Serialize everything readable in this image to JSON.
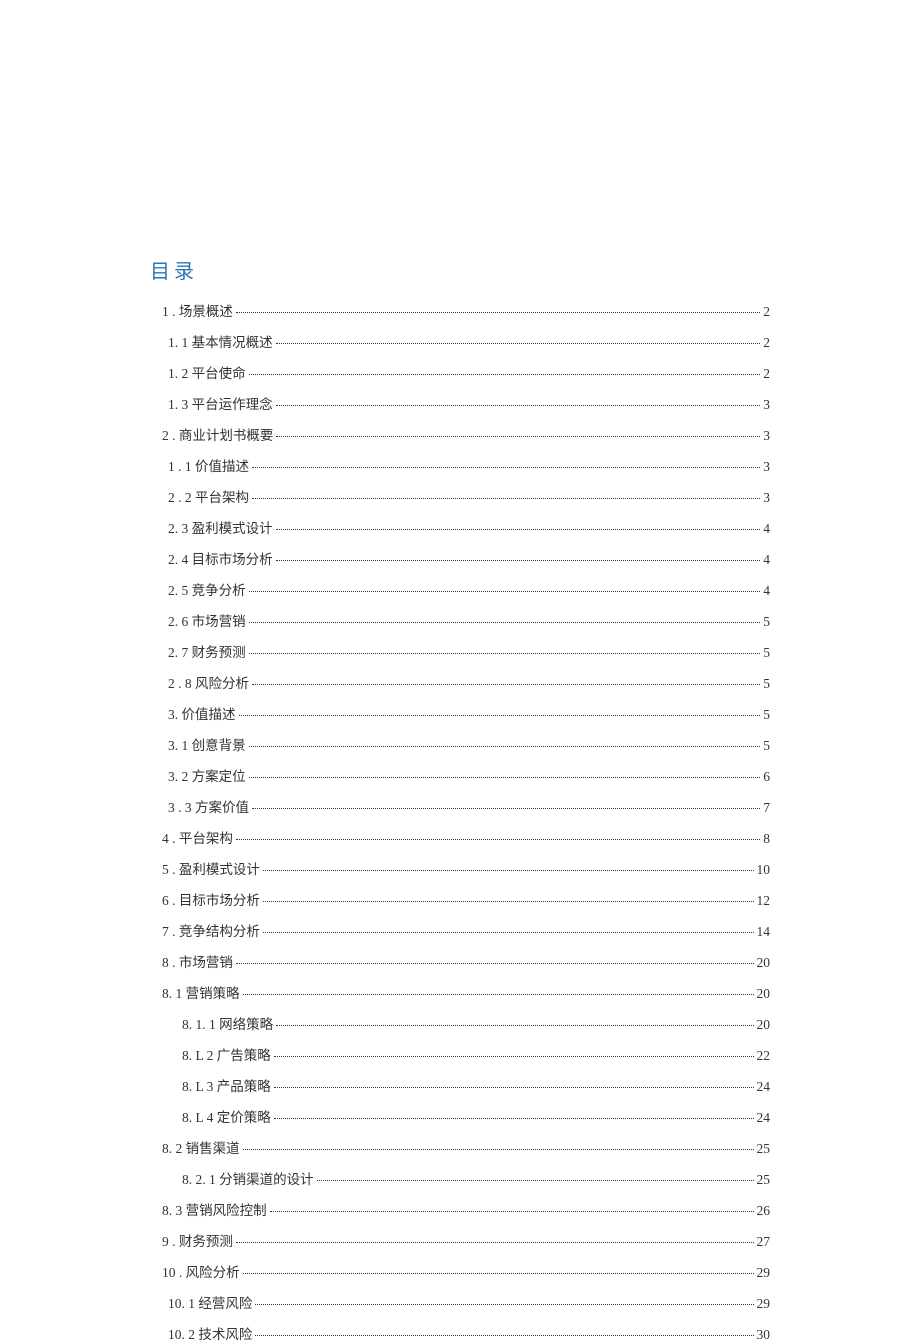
{
  "heading": "目录",
  "toc": [
    {
      "indent": 1,
      "label": "1  . 场景概述",
      "page": "2"
    },
    {
      "indent": 2,
      "label": "1. 1   基本情况概述",
      "page": "2"
    },
    {
      "indent": 2,
      "label": "1. 2   平台使命",
      "page": "2"
    },
    {
      "indent": 2,
      "label": "1. 3   平台运作理念",
      "page": "3"
    },
    {
      "indent": 1,
      "label": "2   . 商业计划书概要",
      "page": "3"
    },
    {
      "indent": 2,
      "label": "1   . 1 价值描述",
      "page": "3"
    },
    {
      "indent": 2,
      "label": "2   . 2 平台架构",
      "page": "3"
    },
    {
      "indent": 2,
      "label": "2. 3 盈利模式设计",
      "page": "4"
    },
    {
      "indent": 2,
      "label": "2. 4 目标市场分析",
      "page": "4"
    },
    {
      "indent": 2,
      "label": "2. 5 竞争分析",
      "page": "4"
    },
    {
      "indent": 2,
      "label": "2. 6 市场营销",
      "page": "5"
    },
    {
      "indent": 2,
      "label": "2. 7 财务预测",
      "page": "5"
    },
    {
      "indent": 2,
      "label": "2   . 8 风险分析",
      "page": "5"
    },
    {
      "indent": 2,
      "label": "3. 价值描述",
      "page": "5"
    },
    {
      "indent": 2,
      "label": "3.   1 创意背景",
      "page": "5"
    },
    {
      "indent": 2,
      "label": "3.   2 方案定位",
      "page": "6"
    },
    {
      "indent": 2,
      "label": "3   . 3 方案价值",
      "page": "7"
    },
    {
      "indent": 1,
      "label": "4   . 平台架构",
      "page": "8"
    },
    {
      "indent": 1,
      "label": "5   . 盈利模式设计",
      "page": "10"
    },
    {
      "indent": 1,
      "label": "6   . 目标市场分析",
      "page": "12"
    },
    {
      "indent": 1,
      "label": "7   . 竞争结构分析",
      "page": "14"
    },
    {
      "indent": 1,
      "label": "8   . 市场营销",
      "page": "20"
    },
    {
      "indent": 1,
      "label": "8. 1 营销策略",
      "page": "20"
    },
    {
      "indent": 3,
      "label": "8. 1.   1 网络策略",
      "page": "20"
    },
    {
      "indent": 3,
      "label": "8. L   2 广告策略",
      "page": "22"
    },
    {
      "indent": 3,
      "label": "8. L   3 产品策略",
      "page": "24"
    },
    {
      "indent": 3,
      "label": "8. L   4 定价策略",
      "page": "24"
    },
    {
      "indent": 1,
      "label": "8. 2 销售渠道",
      "page": "25"
    },
    {
      "indent": 3,
      "label": "8. 2. 1 分销渠道的设计",
      "page": "25"
    },
    {
      "indent": 1,
      "label": "8. 3 营销风险控制",
      "page": "26"
    },
    {
      "indent": 1,
      "label": "9   . 财务预测",
      "page": "27"
    },
    {
      "indent": 1,
      "label": "10   . 风险分析",
      "page": "29"
    },
    {
      "indent": 2,
      "label": "10. 1 经营风险",
      "page": "29"
    },
    {
      "indent": 2,
      "label": "10. 2 技术风险",
      "page": "30"
    }
  ]
}
